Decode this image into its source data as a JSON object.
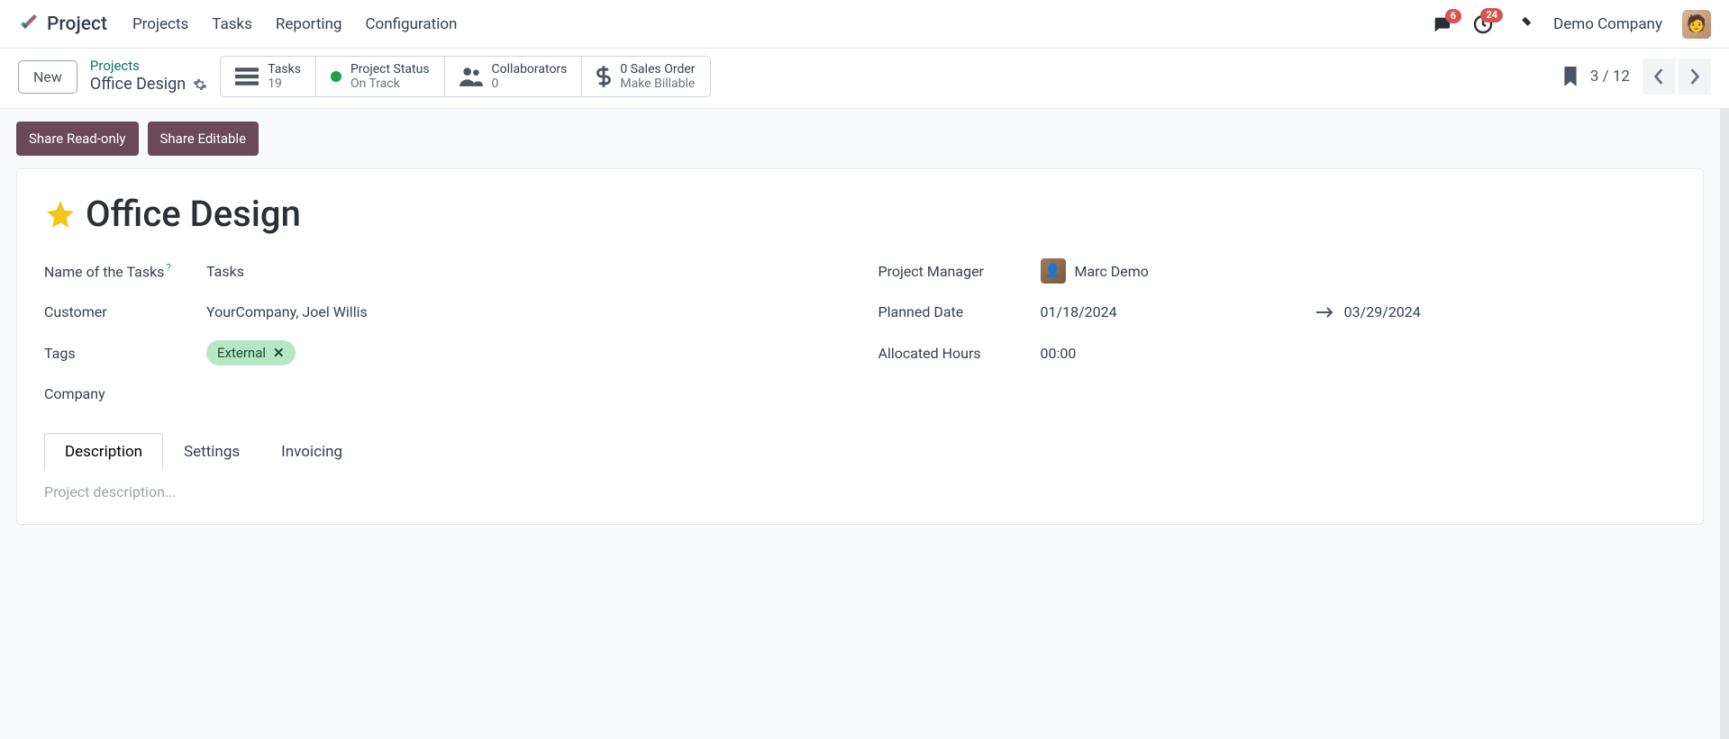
{
  "topbar": {
    "appName": "Project",
    "nav": [
      "Projects",
      "Tasks",
      "Reporting",
      "Configuration"
    ],
    "messagesBadge": "6",
    "activitiesBadge": "24",
    "company": "Demo Company"
  },
  "subbar": {
    "newLabel": "New",
    "breadcrumbTop": "Projects",
    "breadcrumbBottom": "Office Design",
    "stats": {
      "tasks": {
        "label": "Tasks",
        "value": "19"
      },
      "status": {
        "label": "Project Status",
        "value": "On Track"
      },
      "collab": {
        "label": "Collaborators",
        "value": "0"
      },
      "sales": {
        "label": "0 Sales Order",
        "value": "Make Billable"
      }
    },
    "pager": "3 / 12"
  },
  "buttons": {
    "shareReadOnly": "Share Read-only",
    "shareEditable": "Share Editable"
  },
  "form": {
    "title": "Office Design",
    "labels": {
      "nameOfTasks": "Name of the Tasks",
      "customer": "Customer",
      "tags": "Tags",
      "company": "Company",
      "projectManager": "Project Manager",
      "plannedDate": "Planned Date",
      "allocatedHours": "Allocated Hours"
    },
    "values": {
      "nameOfTasks": "Tasks",
      "customer": "YourCompany, Joel Willis",
      "tag": "External",
      "projectManager": "Marc Demo",
      "dateStart": "01/18/2024",
      "dateEnd": "03/29/2024",
      "allocatedHours": "00:00"
    },
    "tabs": {
      "description": "Description",
      "settings": "Settings",
      "invoicing": "Invoicing"
    },
    "descriptionPlaceholder": "Project description..."
  }
}
